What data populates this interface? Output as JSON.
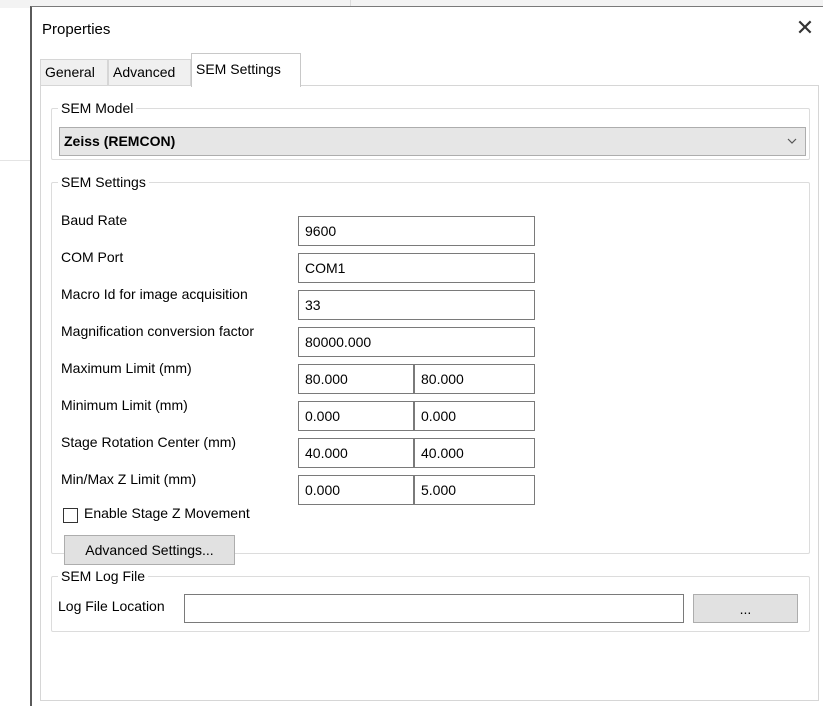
{
  "dialog": {
    "title": "Properties",
    "close_icon": "close-icon"
  },
  "tabs": [
    {
      "label": "General",
      "active": false
    },
    {
      "label": "Advanced",
      "active": false
    },
    {
      "label": "SEM Settings",
      "active": true
    }
  ],
  "sem_model": {
    "group_label": "SEM Model",
    "selected": "Zeiss (REMCON)",
    "dropdown_icon": "chevron-down-icon"
  },
  "sem_settings": {
    "group_label": "SEM Settings",
    "baud_rate": {
      "label": "Baud Rate",
      "value": "9600"
    },
    "com_port": {
      "label": "COM Port",
      "value": "COM1"
    },
    "macro_id": {
      "label": "Macro Id for image acquisition",
      "value": "33"
    },
    "mag_factor": {
      "label": "Magnification conversion factor",
      "value": "80000.000"
    },
    "max_limit": {
      "label": "Maximum Limit (mm)",
      "value1": "80.000",
      "value2": "80.000"
    },
    "min_limit": {
      "label": "Minimum Limit (mm)",
      "value1": "0.000",
      "value2": "0.000"
    },
    "rotation_center": {
      "label": "Stage Rotation Center (mm)",
      "value1": "40.000",
      "value2": "40.000"
    },
    "z_limit": {
      "label": "Min/Max Z Limit (mm)",
      "value1": "0.000",
      "value2": "5.000"
    },
    "enable_z": {
      "label": "Enable Stage Z Movement",
      "checked": false
    },
    "advanced_button": "Advanced Settings..."
  },
  "sem_log": {
    "group_label": "SEM Log File",
    "location_label": "Log File Location",
    "location_value": "",
    "browse_button": "..."
  }
}
